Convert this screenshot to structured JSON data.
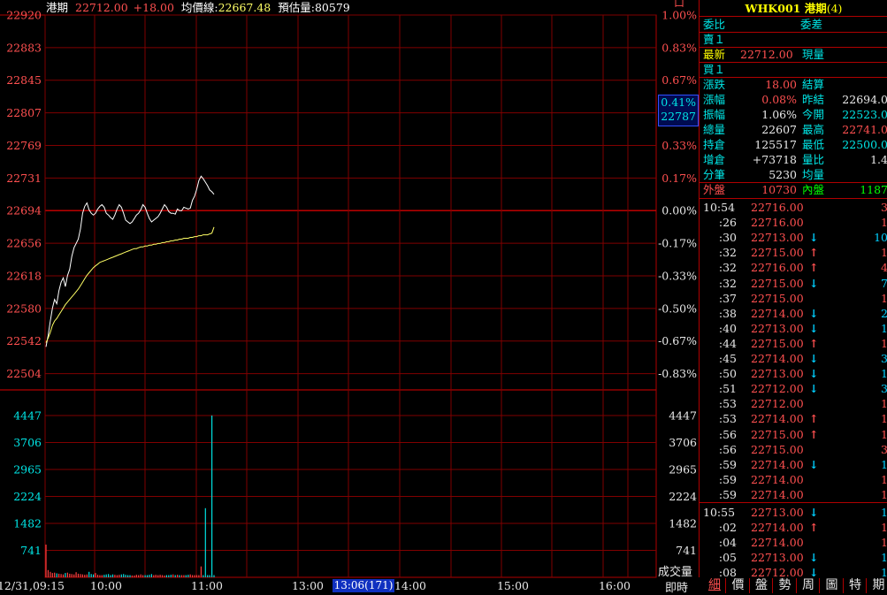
{
  "header": {
    "name": "港期",
    "last": "22712.00",
    "change": "+18.00",
    "avg_label": "均價線:",
    "avg_value": "22667.48",
    "est_label": "預估量:",
    "est_value": "80579"
  },
  "chart_data": [
    {
      "type": "line",
      "title": "",
      "x_ticks": [
        "12/31,09:15",
        "10:00",
        "11:00",
        "13:00",
        "14:00",
        "15:00",
        "16:00"
      ],
      "time_readout": "13:06(171)",
      "ylim": [
        22504,
        22920
      ],
      "y_ticks_left": [
        "22920",
        "22883",
        "22845",
        "22807",
        "22769",
        "22731",
        "22694",
        "22656",
        "22618",
        "22580",
        "22542",
        "22504"
      ],
      "y_ticks_right": [
        "1.00%",
        "0.83%",
        "0.67%",
        "",
        "0.33%",
        "0.17%",
        "0.00%",
        "-0.17%",
        "-0.33%",
        "-0.50%",
        "-0.67%",
        "-0.83%"
      ],
      "y_cursor": {
        "pct": "0.41%",
        "price": "22787"
      },
      "reference": 22694,
      "series": [
        {
          "color": "#ffffff",
          "values": [
            22535,
            22548,
            22565,
            22580,
            22590,
            22585,
            22600,
            22610,
            22615,
            22605,
            22618,
            22625,
            22640,
            22650,
            22655,
            22660,
            22672,
            22690,
            22698,
            22702,
            22694,
            22690,
            22688,
            22690,
            22695,
            22698,
            22700,
            22697,
            22690,
            22688,
            22685,
            22683,
            22688,
            22695,
            22700,
            22697,
            22690,
            22682,
            22680,
            22678,
            22680,
            22684,
            22688,
            22690,
            22694,
            22700,
            22697,
            22690,
            22684,
            22680,
            22682,
            22684,
            22686,
            22690,
            22695,
            22700,
            22697,
            22692,
            22690,
            22690,
            22689,
            22695,
            22693,
            22693,
            22697,
            22696,
            22695,
            22696,
            22705,
            22710,
            22718,
            22728,
            22733,
            22730,
            22726,
            22722,
            22717,
            22715,
            22712
          ]
        },
        {
          "color": "#ffff66",
          "values": [
            22540,
            22545,
            22552,
            22560,
            22565,
            22568,
            22572,
            22576,
            22580,
            22584,
            22587,
            22590,
            22593,
            22596,
            22599,
            22602,
            22606,
            22610,
            22614,
            22618,
            22621,
            22624,
            22627,
            22629,
            22631,
            22633,
            22634,
            22635,
            22636,
            22637,
            22638,
            22639,
            22640,
            22641,
            22642,
            22643,
            22644,
            22645,
            22646,
            22647,
            22648,
            22649,
            22649,
            22650,
            22651,
            22651,
            22652,
            22652,
            22653,
            22653,
            22654,
            22654,
            22655,
            22655,
            22656,
            22656,
            22657,
            22657,
            22658,
            22658,
            22659,
            22659,
            22660,
            22660,
            22661,
            22661,
            22661,
            22662,
            22662,
            22663,
            22663,
            22664,
            22664,
            22665,
            22665,
            22665,
            22666,
            22667,
            22674
          ]
        }
      ]
    },
    {
      "type": "bar",
      "title": "",
      "ylabel": "成交量",
      "ylim": [
        0,
        4447
      ],
      "y_ticks": [
        "4447",
        "3706",
        "2965",
        "2224",
        "1482",
        "741"
      ],
      "values": [
        900,
        200,
        150,
        120,
        130,
        110,
        100,
        90,
        80,
        120,
        130,
        100,
        90,
        80,
        140,
        100,
        90,
        80,
        70,
        80,
        150,
        90,
        80,
        120,
        70,
        60,
        60,
        70,
        80,
        90,
        60,
        80,
        70,
        60,
        70,
        80,
        90,
        70,
        60,
        60,
        50,
        50,
        70,
        60,
        80,
        60,
        60,
        60,
        70,
        90,
        60,
        70,
        60,
        70,
        60,
        50,
        60,
        60,
        70,
        80,
        60,
        70,
        60,
        60,
        60,
        60,
        70,
        80,
        60,
        60,
        60,
        60,
        300,
        60,
        1900,
        60,
        60,
        4447,
        60
      ]
    }
  ],
  "quote": {
    "title": "WHK001 港期",
    "title_suffix": "(4)",
    "weibi": "委比",
    "weicha": "委差",
    "sell1": "賣１",
    "latest_label": "最新",
    "latest_value": "22712.00",
    "now_label": "現量",
    "buy1": "買１",
    "rows": [
      {
        "l1": "漲跌",
        "v1": "18.00",
        "l2": "結算",
        "v2": ""
      },
      {
        "l1": "漲幅",
        "v1": "0.08%",
        "l2": "昨結",
        "v2": "22694.0"
      },
      {
        "l1": "振幅",
        "v1": "1.06%",
        "l2": "今開",
        "v2": "22523.0"
      },
      {
        "l1": "總量",
        "v1": "22607",
        "l2": "最高",
        "v2": "22741.0"
      },
      {
        "l1": "持倉",
        "v1": "125517",
        "l2": "最低",
        "v2": "22500.0"
      },
      {
        "l1": "增倉",
        "v1": "+73718",
        "l2": "量比",
        "v2": "1.4"
      },
      {
        "l1": "分筆",
        "v1": "5230",
        "l2": "均量",
        "v2": ""
      }
    ],
    "outer_label": "外盤",
    "outer_value": "10730",
    "inner_label": "內盤",
    "inner_value": "1187"
  },
  "ticks": [
    {
      "t": "10:54",
      "p": "22716.00",
      "d": "",
      "v": "3"
    },
    {
      "t": ":26",
      "p": "22716.00",
      "d": "",
      "v": "1"
    },
    {
      "t": ":30",
      "p": "22713.00",
      "d": "down",
      "v": "10"
    },
    {
      "t": ":32",
      "p": "22715.00",
      "d": "up",
      "v": "1"
    },
    {
      "t": ":32",
      "p": "22716.00",
      "d": "up",
      "v": "4"
    },
    {
      "t": ":32",
      "p": "22715.00",
      "d": "down",
      "v": "7"
    },
    {
      "t": ":37",
      "p": "22715.00",
      "d": "",
      "v": "1"
    },
    {
      "t": ":38",
      "p": "22714.00",
      "d": "down",
      "v": "2"
    },
    {
      "t": ":40",
      "p": "22713.00",
      "d": "down",
      "v": "1"
    },
    {
      "t": ":44",
      "p": "22715.00",
      "d": "up",
      "v": "1"
    },
    {
      "t": ":45",
      "p": "22714.00",
      "d": "down",
      "v": "3"
    },
    {
      "t": ":50",
      "p": "22713.00",
      "d": "down",
      "v": "1"
    },
    {
      "t": ":51",
      "p": "22712.00",
      "d": "down",
      "v": "3"
    },
    {
      "t": ":53",
      "p": "22712.00",
      "d": "",
      "v": "1"
    },
    {
      "t": ":53",
      "p": "22714.00",
      "d": "up",
      "v": "1"
    },
    {
      "t": ":56",
      "p": "22715.00",
      "d": "up",
      "v": "1"
    },
    {
      "t": ":56",
      "p": "22715.00",
      "d": "",
      "v": "3"
    },
    {
      "t": ":59",
      "p": "22714.00",
      "d": "down",
      "v": "1"
    },
    {
      "t": ":59",
      "p": "22714.00",
      "d": "",
      "v": "1"
    },
    {
      "t": ":59",
      "p": "22714.00",
      "d": "",
      "v": "1"
    },
    {
      "t": "10:55",
      "p": "22713.00",
      "d": "down",
      "v": "1"
    },
    {
      "t": ":02",
      "p": "22714.00",
      "d": "up",
      "v": "1"
    },
    {
      "t": ":04",
      "p": "22714.00",
      "d": "",
      "v": "1"
    },
    {
      "t": ":05",
      "p": "22713.00",
      "d": "down",
      "v": "1"
    },
    {
      "t": ":08",
      "p": "22712.00",
      "d": "down",
      "v": "1"
    }
  ],
  "footer": {
    "realtime": "即時"
  },
  "tabs": [
    "細",
    "價",
    "盤",
    "勢",
    "周",
    "圖",
    "特",
    "期"
  ],
  "tab_icon_mark": "口"
}
